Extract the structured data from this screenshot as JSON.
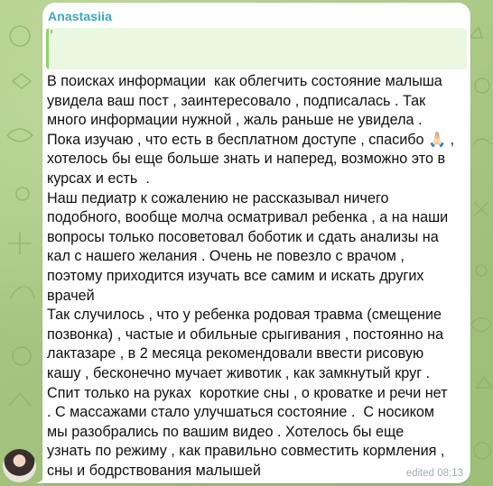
{
  "chat": {
    "sender_name": "Anastasiia",
    "message_lines": [
      "В поисках информации  как облегчить состояние малыша",
      "увидела ваш пост , заинтересовало , подписалась . Так",
      "много информации нужной , жаль раньше не увидела .",
      "Пока изучаю , что есть в бесплатном доступе , спасибо 🙏🏻 ,",
      "хотелось бы еще больше знать и наперед, возможно это в",
      "курсах и есть  .",
      "Наш педиатр к сожалению не рассказывал ничего",
      "подобного, вообще молча осматривал ребенка , а на наши",
      "вопросы только посоветовал боботик и сдать анализы на",
      "кал с нашего желания . Очень не повезло с врачом ,",
      "поэтому приходится изучать все самим и искать других",
      "врачей",
      "Так случилось , что у ребенка родовая травма (смещение",
      "позвонка) , частые и обильные срыгивания , постоянно на",
      "лактазаре , в 2 месяца рекомендовали ввести рисовую",
      "кашу , бесконечно мучает животик , как замкнутый круг .",
      "Спит только на руках  короткие сны , о кроватке и речи нет",
      ". С массажами стало улучшаться состояние .  С носиком",
      "мы разобрались по вашим видео . Хотелось бы еще",
      "узнать по режиму , как правильно совместить кормления ,",
      "сны и бодрствования малышей"
    ],
    "meta_text": "edited 08:13",
    "sender_color": "#3ca5c6",
    "reply_bar_color": "#8fd36a",
    "reply_bg_color": "#eaf7e1",
    "background_color": "#a9c785"
  }
}
